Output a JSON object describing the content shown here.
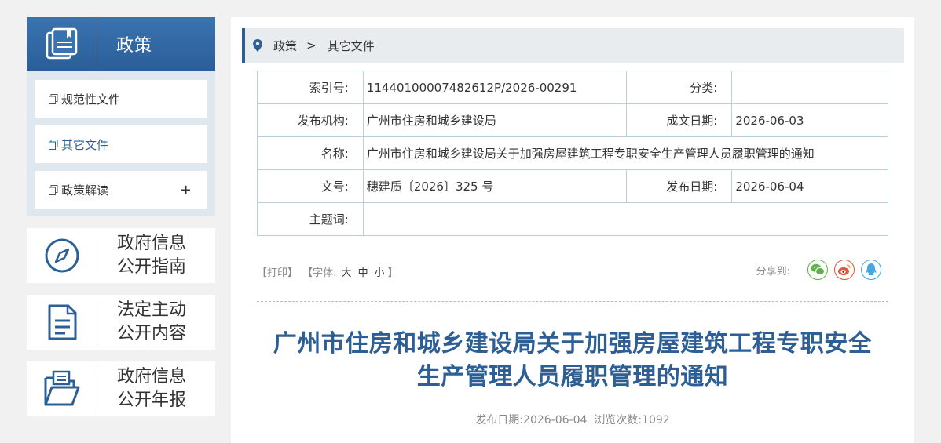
{
  "sidebar": {
    "header_title": "政策",
    "header_icon": "book-icon",
    "menu": [
      {
        "label": "规范性文件",
        "active": false
      },
      {
        "label": "其它文件",
        "active": true
      },
      {
        "label": "政策解读",
        "active": false,
        "expand": "+"
      }
    ],
    "cards": [
      {
        "line1": "政府信息",
        "line2": "公开指南",
        "icon": "compass-icon"
      },
      {
        "line1": "法定主动",
        "line2": "公开内容",
        "icon": "document-icon"
      },
      {
        "line1": "政府信息",
        "line2": "公开年报",
        "icon": "folder-icon"
      }
    ]
  },
  "breadcrumb": {
    "icon": "location-pin-icon",
    "items": [
      "政策",
      "其它文件"
    ],
    "separator": ">"
  },
  "info_table": {
    "index_label": "索引号:",
    "index_value": "11440100007482612P/2026-00291",
    "category_label": "分类:",
    "category_value": "",
    "org_label": "发布机构:",
    "org_value": "广州市住房和城乡建设局",
    "written_label": "成文日期:",
    "written_value": "2026-06-03",
    "name_label": "名称:",
    "name_value": "广州市住房和城乡建设局关于加强房屋建筑工程专职安全生产管理人员履职管理的通知",
    "docno_label": "文号:",
    "docno_value": "穗建质〔2026〕325 号",
    "pubdate_label": "发布日期:",
    "pubdate_value": "2026-06-04",
    "keyword_label": "主题词:",
    "keyword_value": ""
  },
  "tools": {
    "print": "【打印】",
    "font_open": "【字体:",
    "font_large": "大",
    "font_medium": "中",
    "font_small": "小",
    "font_close": "】"
  },
  "share": {
    "label": "分享到:",
    "items": [
      "wechat-icon",
      "weibo-icon",
      "qq-icon"
    ],
    "colors": {
      "wechat": "#5fb24a",
      "weibo": "#e2563a",
      "qq": "#4aa6e0"
    }
  },
  "article": {
    "title_line1": "广州市住房和城乡建设局关于加强房屋建筑工程专职安全",
    "title_line2": "生产管理人员履职管理的通知",
    "meta_date_label": "发布日期:",
    "meta_date": "2026-06-04",
    "meta_views_label": "浏览次数:",
    "meta_views": "1092"
  },
  "colors": {
    "brand": "#2d5f95",
    "sidebar_bg": "#dfe8ef",
    "table_border": "#b8cfe0"
  }
}
